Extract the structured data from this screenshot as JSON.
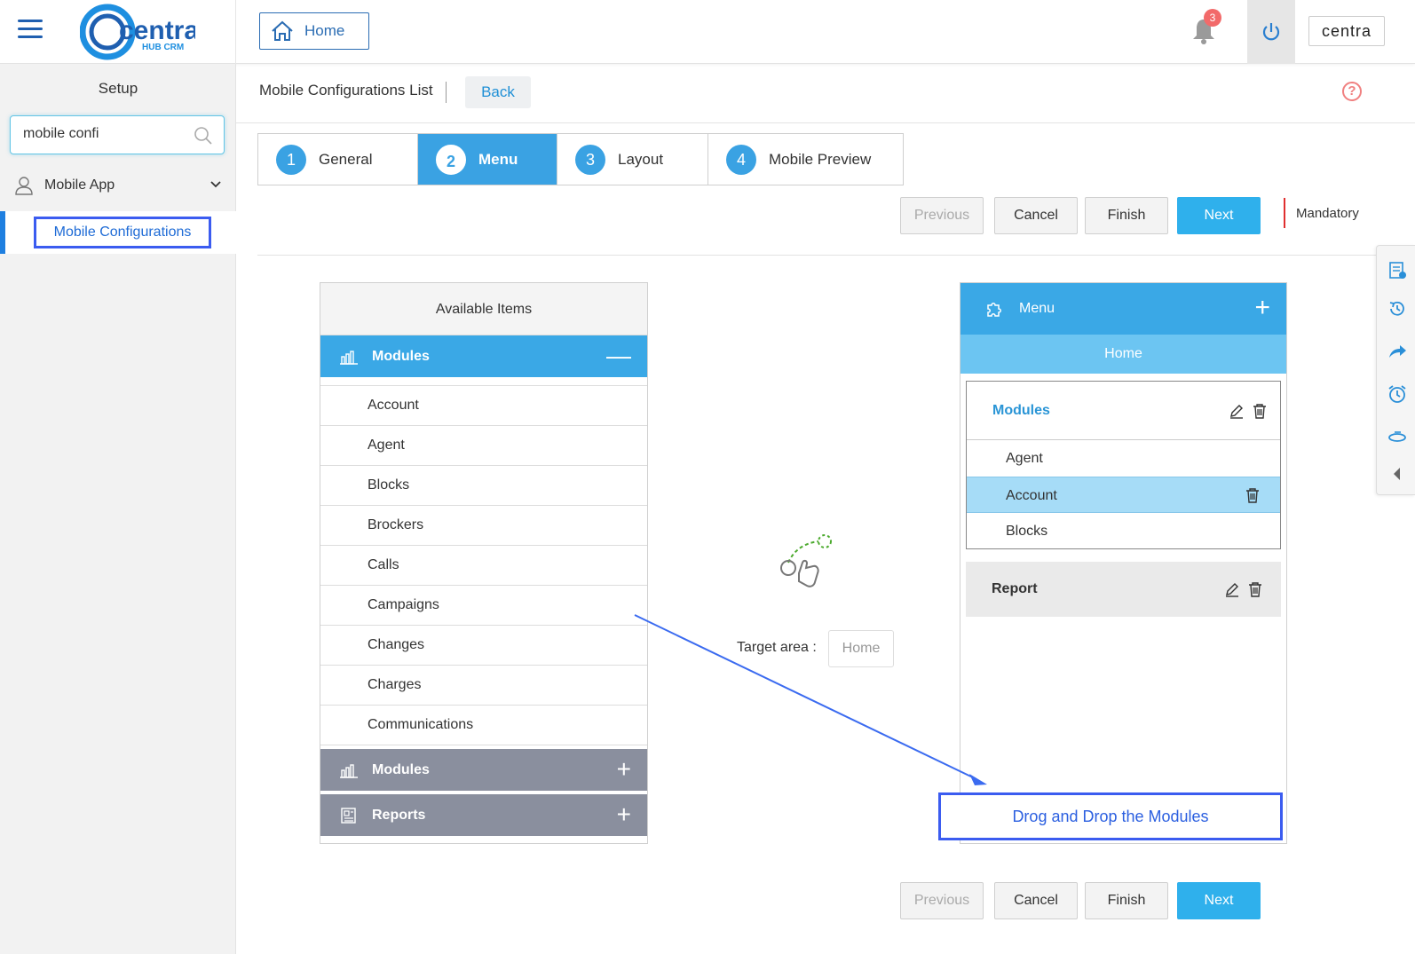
{
  "app": {
    "logo_text": "centra",
    "logo_sub": "HUB CRM",
    "home_label": "Home",
    "notification_count": "3",
    "profile_badge": "centra"
  },
  "sidebar": {
    "title": "Setup",
    "search_value": "mobile confi",
    "group_label": "Mobile App",
    "active_item": "Mobile Configurations"
  },
  "header": {
    "title": "Mobile Configurations List",
    "back_label": "Back",
    "help_glyph": "?"
  },
  "steps": [
    {
      "num": "1",
      "label": "General"
    },
    {
      "num": "2",
      "label": "Menu"
    },
    {
      "num": "3",
      "label": "Layout"
    },
    {
      "num": "4",
      "label": "Mobile Preview"
    }
  ],
  "actions": {
    "previous": "Previous",
    "cancel": "Cancel",
    "finish": "Finish",
    "next": "Next",
    "mandatory": "Mandatory"
  },
  "available": {
    "title": "Available Items",
    "open_group": "Modules",
    "items": [
      "Account",
      "Agent",
      "Blocks",
      "Brockers",
      "Calls",
      "Campaigns",
      "Changes",
      "Charges",
      "Communications"
    ],
    "collapsed_groups": [
      "Modules",
      "Reports"
    ]
  },
  "target": {
    "label": "Target area :",
    "value": "Home"
  },
  "menu_panel": {
    "title": "Menu",
    "home_label": "Home",
    "modules_label": "Modules",
    "module_items": [
      "Agent",
      "Account",
      "Blocks"
    ],
    "report_label": "Report",
    "drop_hint": "Drog and Drop the Modules"
  },
  "colors": {
    "accent": "#3aa8e6",
    "primary_button": "#2fb0ec",
    "annotation": "#3b5cf0"
  }
}
